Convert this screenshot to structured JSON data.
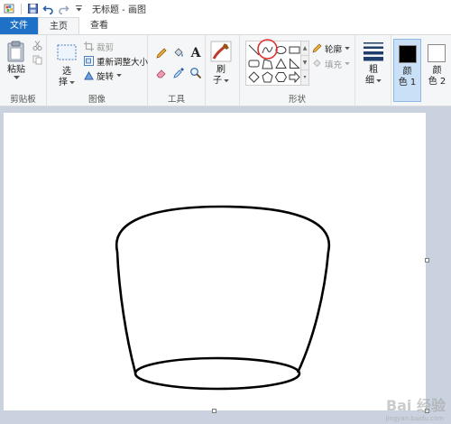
{
  "window": {
    "title": "无标题 - 画图"
  },
  "tabs": [
    {
      "label": "文件"
    },
    {
      "label": "主页"
    },
    {
      "label": "查看"
    }
  ],
  "clipboard": {
    "paste_label": "粘贴",
    "group_label": "剪贴板"
  },
  "image": {
    "select_label": "选",
    "select_label2": "择",
    "crop_label": "裁剪",
    "resize_label": "重新调整大小",
    "rotate_label": "旋转",
    "group_label": "图像"
  },
  "tools": {
    "group_label": "工具",
    "text_glyph": "A"
  },
  "brushes": {
    "label": "刷",
    "label2": "子"
  },
  "shapes": {
    "outline_label": "轮廓",
    "fill_label": "填充",
    "group_label": "形状"
  },
  "size": {
    "label": "粗",
    "label2": "细"
  },
  "colors": {
    "color1_label": "颜",
    "color1_label2": "色 1",
    "color2_label": "颜",
    "color2_label2": "色 2",
    "color1_value": "#000000",
    "color2_value": "#ffffff",
    "highlight": "#e0322c"
  },
  "watermark": {
    "text": "Bai 经验",
    "sub": "jingyan.baidu.com"
  }
}
